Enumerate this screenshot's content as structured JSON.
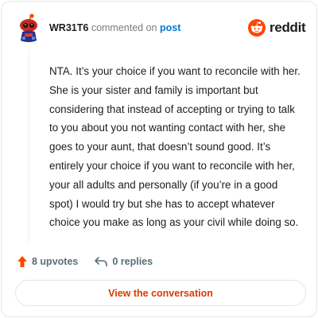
{
  "comment": {
    "username": "WR31T6",
    "action_text": "commented on",
    "post_link": "post",
    "body": "NTA. It’s your choice if you want to reconcile with her. She is your sister and family is important but considering that instead of accepting or trying to talk to you about you not wanting contact with her, she goes to your aunt, that doesn’t sound good. It’s entirely your choice if you want to reconcile with her, your all adults and personally (if you’re in a good spot) I would try but she has to accept whatever choice you make as long as your civil while doing so."
  },
  "brand": {
    "wordmark": "reddit",
    "color": "#ff4500"
  },
  "stats": {
    "upvotes": "8 upvotes",
    "replies": "0 replies"
  },
  "cta": {
    "label": "View the conversation"
  },
  "colors": {
    "accent": "#d93a00",
    "upvote": "#ff4500",
    "link": "#0079d3",
    "muted": "#576f76"
  },
  "icons": {
    "avatar": "snoo-avatar",
    "logo": "reddit-snoo-icon",
    "upvote": "upvote-arrow-icon",
    "reply": "reply-arrow-icon"
  }
}
